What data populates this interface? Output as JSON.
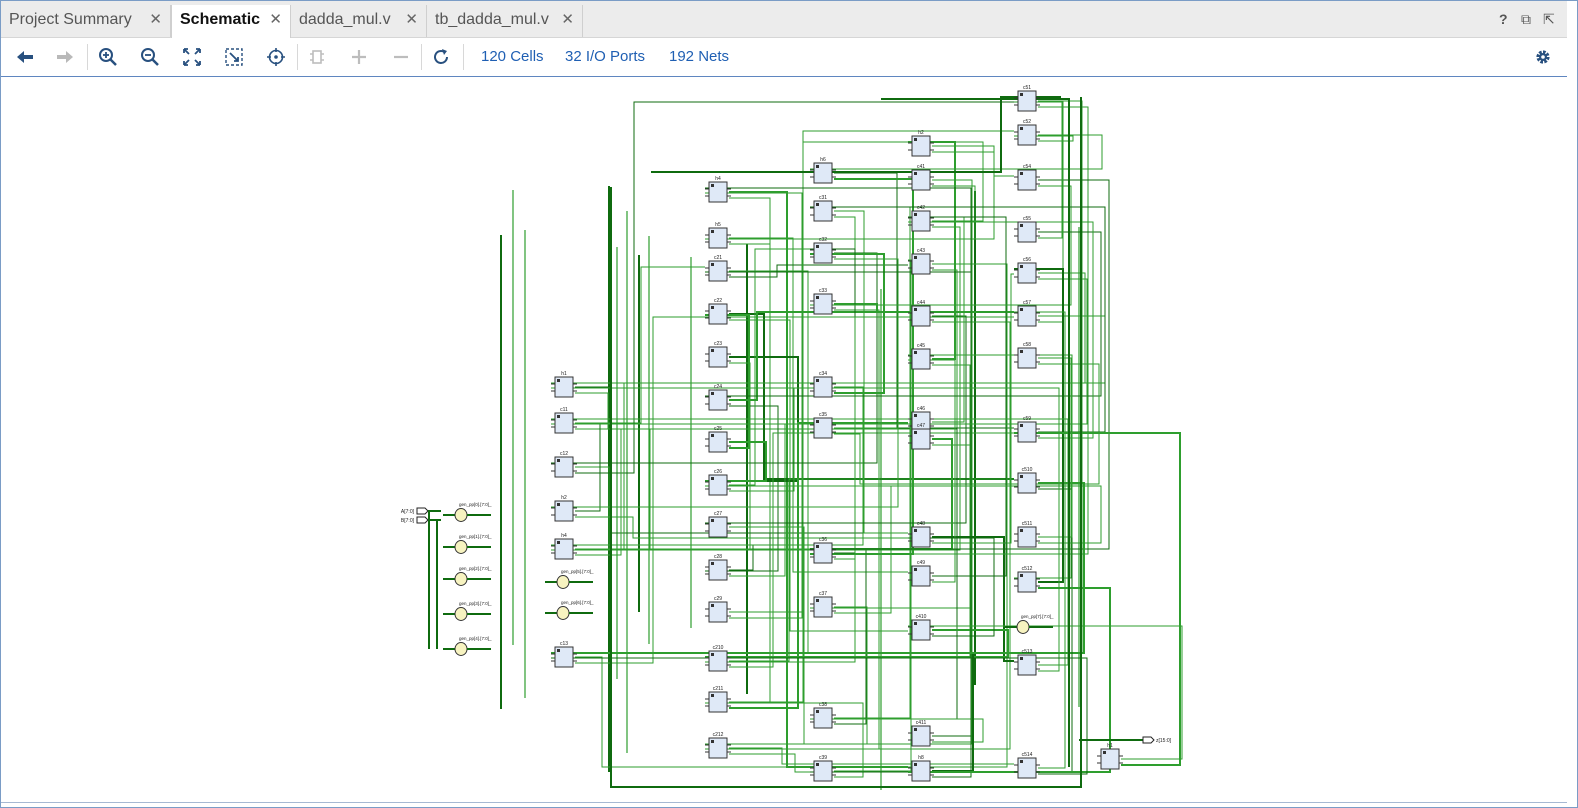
{
  "tabs": [
    {
      "label": "Project Summary",
      "active": false
    },
    {
      "label": "Schematic",
      "active": true
    },
    {
      "label": "dadda_mul.v",
      "active": false
    },
    {
      "label": "tb_dadda_mul.v",
      "active": false
    }
  ],
  "close_glyph": "✕",
  "window_controls": {
    "help": "?",
    "restore": "⧉",
    "maximize": "⇱"
  },
  "toolbar": {
    "stats": {
      "cells": "120 Cells",
      "ports": "32 I/O Ports",
      "nets": "192 Nets"
    }
  },
  "colors": {
    "wire": "#2e9e2e",
    "wire_dark": "#0f6b0f",
    "cell_fill": "#dfe9f7",
    "cell_stroke": "#333333",
    "buffer_fill": "#f7f3c0",
    "link": "#1f5fb3",
    "icon": "#28507f"
  },
  "icons": [
    "back-arrow-icon",
    "forward-arrow-icon",
    "zoom-in-icon",
    "zoom-out-icon",
    "fit-icon",
    "zoom-selection-icon",
    "crosshair-icon",
    "device-icon",
    "expand-icon",
    "collapse-icon",
    "refresh-icon",
    "gear-icon"
  ],
  "schematic": {
    "inputs": [
      "A[7:0]",
      "B[7:0]"
    ],
    "output": "z[15:0]",
    "buffers": [
      "gen_pp[0].[7:0]_",
      "gen_pp[1].[7:0]_",
      "gen_pp[2].[7:0]_",
      "gen_pp[3].[7:0]_",
      "gen_pp[4].[7:0]_",
      "gen_pp[5].[7:0]_",
      "gen_pp[6].[7:0]_",
      "gen_pp[7].[7:0]_"
    ],
    "cells": [
      "h1",
      "c11",
      "c12",
      "h2",
      "h4",
      "c13",
      "h4",
      "h5",
      "c21",
      "c22",
      "c23",
      "c24",
      "c25",
      "c26",
      "c27",
      "c28",
      "c29",
      "c210",
      "c211",
      "c212",
      "h6",
      "c31",
      "c32",
      "c33",
      "c34",
      "c35",
      "c36",
      "c37",
      "c38",
      "c39",
      "h2",
      "c41",
      "c42",
      "c43",
      "c44",
      "c45",
      "c46",
      "c47",
      "c48",
      "c49",
      "c410",
      "c411",
      "h8",
      "c51",
      "c52",
      "c54",
      "c55",
      "c56",
      "c57",
      "c58",
      "c59",
      "c510",
      "c511",
      "c512",
      "c513",
      "c514"
    ]
  }
}
